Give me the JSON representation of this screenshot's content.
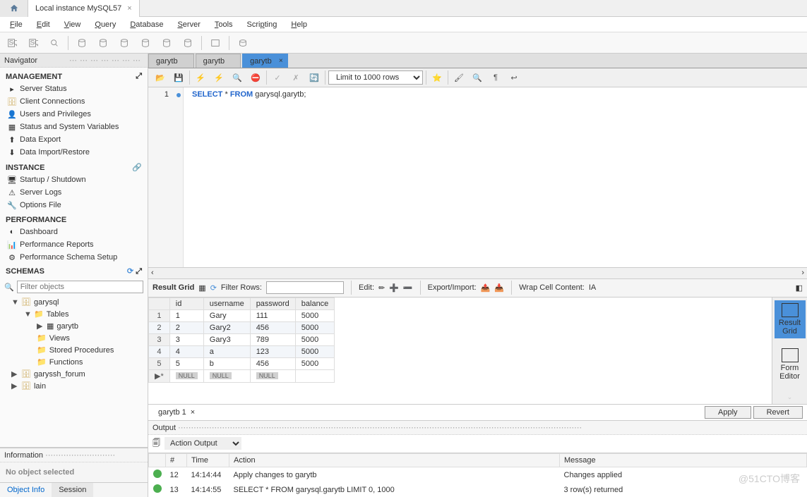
{
  "app_tab": "Local instance MySQL57",
  "menu": {
    "file": "File",
    "edit": "Edit",
    "view": "View",
    "query": "Query",
    "database": "Database",
    "server": "Server",
    "tools": "Tools",
    "scripting": "Scripting",
    "help": "Help"
  },
  "navigator": {
    "title": "Navigator",
    "sections": {
      "management": "MANAGEMENT",
      "instance": "INSTANCE",
      "performance": "PERFORMANCE",
      "schemas": "SCHEMAS"
    },
    "mgmt_items": [
      "Server Status",
      "Client Connections",
      "Users and Privileges",
      "Status and System Variables",
      "Data Export",
      "Data Import/Restore"
    ],
    "inst_items": [
      "Startup / Shutdown",
      "Server Logs",
      "Options File"
    ],
    "perf_items": [
      "Dashboard",
      "Performance Reports",
      "Performance Schema Setup"
    ],
    "filter_placeholder": "Filter objects",
    "tree": {
      "db1": "garysql",
      "tables": "Tables",
      "table1": "garytb",
      "views": "Views",
      "sp": "Stored Procedures",
      "fn": "Functions",
      "db2": "garyssh_forum",
      "db3": "lain"
    },
    "info_title": "Information",
    "no_object": "No object selected",
    "tab_obj": "Object Info",
    "tab_sess": "Session"
  },
  "editor_tabs": [
    "garytb",
    "garytb",
    "garytb"
  ],
  "limit_label": "Limit to 1000 rows",
  "sql": {
    "line": "1",
    "kw1": "SELECT",
    "star": "*",
    "kw2": "FROM",
    "rest": "garysql.garytb;"
  },
  "result_toolbar": {
    "grid": "Result Grid",
    "filter": "Filter Rows:",
    "edit": "Edit:",
    "export": "Export/Import:",
    "wrap": "Wrap Cell Content:"
  },
  "columns": [
    "id",
    "username",
    "password",
    "balance"
  ],
  "rows": [
    {
      "n": "1",
      "id": "1",
      "u": "Gary",
      "p": "111",
      "b": "5000"
    },
    {
      "n": "2",
      "id": "2",
      "u": "Gary2",
      "p": "456",
      "b": "5000"
    },
    {
      "n": "3",
      "id": "3",
      "u": "Gary3",
      "p": "789",
      "b": "5000"
    },
    {
      "n": "4",
      "id": "4",
      "u": "a",
      "p": "123",
      "b": "5000"
    },
    {
      "n": "5",
      "id": "5",
      "u": "b",
      "p": "456",
      "b": "5000"
    }
  ],
  "null": "NULL",
  "side": {
    "rg": "Result\nGrid",
    "fe": "Form\nEditor"
  },
  "result_tab": "garytb 1",
  "apply": "Apply",
  "revert": "Revert",
  "output": {
    "title": "Output",
    "sel": "Action Output",
    "hash": "#",
    "time": "Time",
    "action": "Action",
    "message": "Message",
    "rows": [
      {
        "n": "12",
        "t": "14:14:44",
        "a": "Apply changes to garytb",
        "m": "Changes applied"
      },
      {
        "n": "13",
        "t": "14:14:55",
        "a": "SELECT * FROM garysql.garytb LIMIT 0, 1000",
        "m": "3 row(s) returned"
      }
    ]
  },
  "watermark": "@51CTO博客"
}
